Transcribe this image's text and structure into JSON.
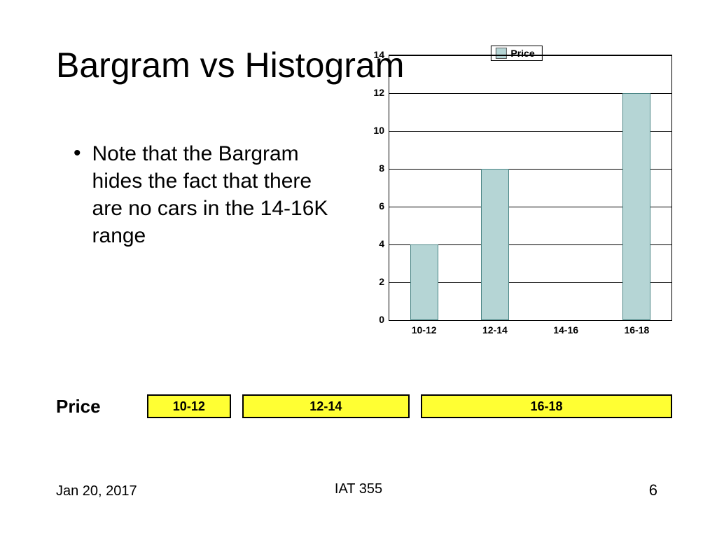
{
  "header": {
    "title": "Bargram vs Histogram"
  },
  "bullet": {
    "marker": "•",
    "text": "Note that the Bargram hides the fact that there are no cars in the 14-16K range"
  },
  "chart_data": {
    "type": "bar",
    "legend": "Price",
    "categories": [
      "10-12",
      "12-14",
      "14-16",
      "16-18"
    ],
    "values": [
      4,
      8,
      0,
      12
    ],
    "ylim": [
      0,
      14
    ],
    "yticks": [
      0,
      2,
      4,
      6,
      8,
      10,
      12,
      14
    ],
    "bar_color": "#b5d5d5"
  },
  "bargram": {
    "label": "Price",
    "segments": [
      {
        "label": "10-12",
        "weight": 4
      },
      {
        "label": "12-14",
        "weight": 8
      },
      {
        "label": "16-18",
        "weight": 12
      }
    ]
  },
  "footer": {
    "date": "Jan 20, 2017",
    "course": "IAT 355",
    "page": "6"
  }
}
